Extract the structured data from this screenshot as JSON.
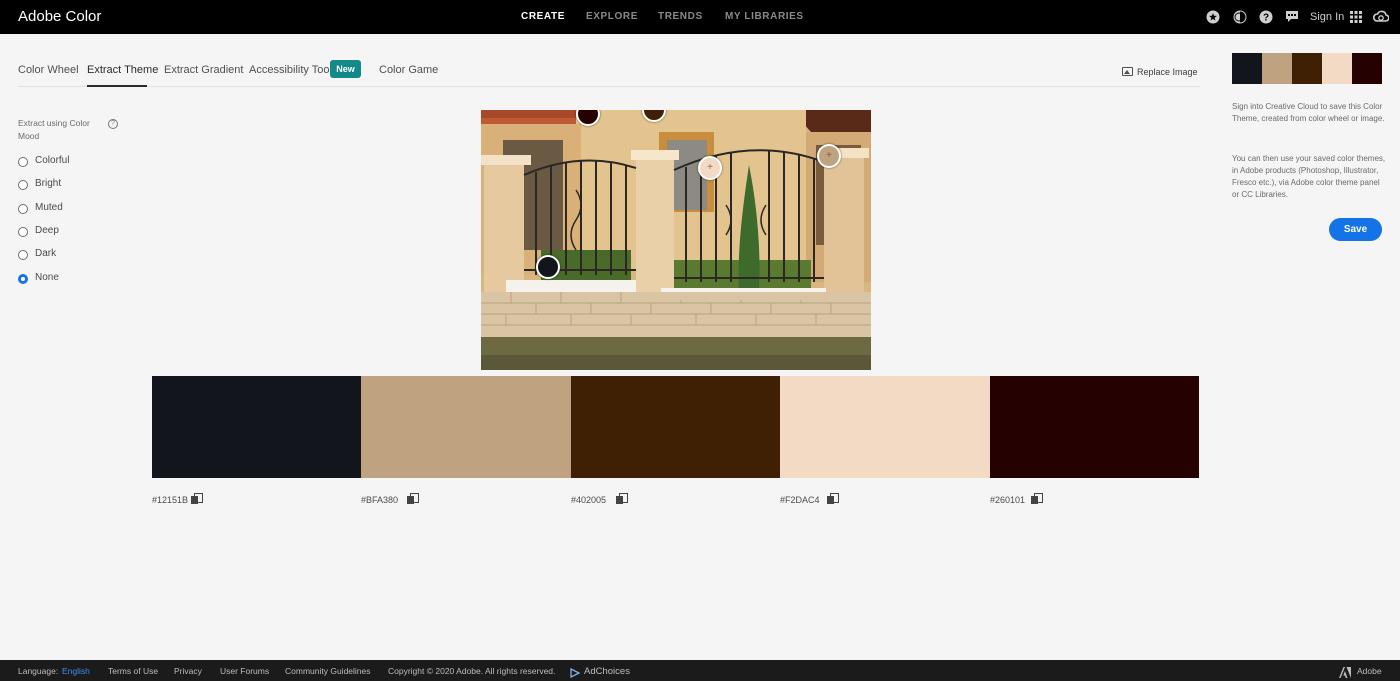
{
  "brand": "Adobe Color",
  "nav": {
    "items": [
      "CREATE",
      "EXPLORE",
      "TRENDS",
      "MY LIBRARIES"
    ],
    "active": "CREATE"
  },
  "header_right": {
    "icons": [
      "star-icon",
      "contrast-icon",
      "help-icon",
      "chat-icon",
      "apps-grid-icon",
      "creative-cloud-icon"
    ],
    "signin": "Sign In"
  },
  "tabs": {
    "items": [
      "Color Wheel",
      "Extract Theme",
      "Extract Gradient",
      "Accessibility Tools",
      "Color Game"
    ],
    "active": "Extract Theme",
    "badge": "New",
    "replace_image": "Replace Image"
  },
  "mood": {
    "title": "Extract using Color Mood",
    "help": "?",
    "options": [
      "Colorful",
      "Bright",
      "Muted",
      "Deep",
      "Dark",
      "None"
    ],
    "selected": "None"
  },
  "theme": {
    "colors": [
      "#12151B",
      "#BFA380",
      "#402005",
      "#F2DAC4",
      "#260101"
    ],
    "hex_labels": [
      "#12151B",
      "#BFA380",
      "#402005",
      "#F2DAC4",
      "#260101"
    ]
  },
  "right_panel": {
    "text1": "Sign into Creative Cloud to save this Color Theme, created from color wheel or image.",
    "text2": "You can then use your saved color themes, in Adobe products (Photoshop, Illustrator, Fresco etc.), via Adobe color theme panel or CC Libraries.",
    "save": "Save"
  },
  "footer": {
    "language_label": "Language:",
    "language_value": "English",
    "links": [
      "Terms of Use",
      "Privacy",
      "User Forums",
      "Community Guidelines"
    ],
    "copyright": "Copyright © 2020 Adobe. All rights reserved.",
    "adchoices": "AdChoices",
    "adobe": "Adobe"
  },
  "colors": {
    "accent": "#1473e6",
    "badge": "#128a8a",
    "topbar": "#000000",
    "footer": "#1b1b1b"
  }
}
